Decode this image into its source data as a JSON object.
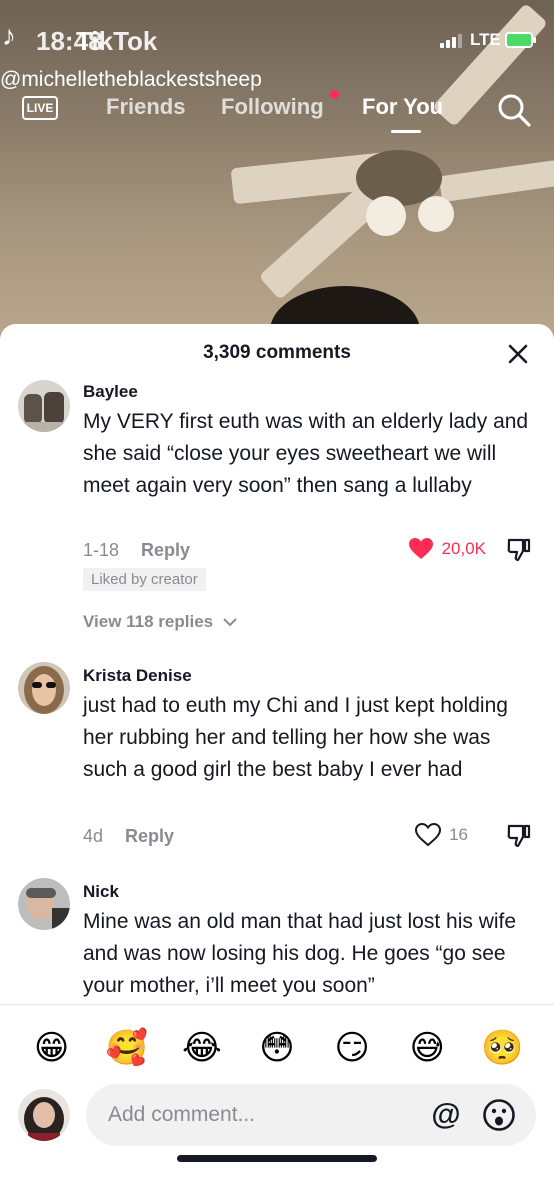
{
  "status_bar": {
    "time": "18:48",
    "brand": "TikTok",
    "network": "LTE"
  },
  "video": {
    "handle": "@michelletheblackestsheep"
  },
  "top_nav": {
    "live_label": "LIVE",
    "tabs": [
      {
        "label": "Friends"
      },
      {
        "label": "Following",
        "has_dot": true
      },
      {
        "label": "For You",
        "active": true
      }
    ]
  },
  "comments_sheet": {
    "title": "3,309 comments",
    "comments": [
      {
        "name": "Baylee",
        "text": "My VERY first euth was with an elderly lady and she said “close your eyes sweetheart we will meet again very soon” then sang a lullaby",
        "date": "1-18",
        "reply_label": "Reply",
        "likes": "20,0K",
        "liked": true,
        "badge": "Liked by creator",
        "view_replies": "View 118 replies"
      },
      {
        "name": "Krista Denise",
        "text": "just had to euth my Chi and I just kept holding her rubbing her and telling her how she was such a good girl the best baby I ever had",
        "date": "4d",
        "reply_label": "Reply",
        "likes": "16",
        "liked": false
      },
      {
        "name": "Nick",
        "text": "Mine was an old man that had just lost his wife and was now losing his dog. He goes “go see your mother, i’ll meet you soon”",
        "liked": false
      }
    ]
  },
  "emoji_bar": [
    "😁",
    "🥰",
    "😂",
    "😳",
    "😏",
    "😅",
    "🥺"
  ],
  "composer": {
    "placeholder": "Add comment..."
  },
  "colors": {
    "accent": "#fe2c55",
    "text": "#161823",
    "muted": "#8a8b91"
  }
}
